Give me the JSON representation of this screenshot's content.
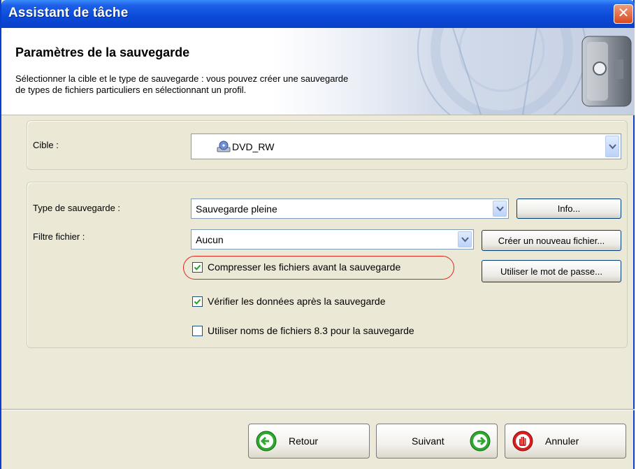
{
  "window": {
    "title": "Assistant de tâche",
    "close_glyph": "✕"
  },
  "header": {
    "title": "Paramètres de la sauvegarde",
    "description_line1": "Sélectionner la cible et le type de sauvegarde : vous pouvez créer une sauvegarde",
    "description_line2": "de types de fichiers particuliers en sélectionnant un profil.",
    "art_icon": "safe-icon"
  },
  "target": {
    "label": "Cible :",
    "value": "DVD_RW",
    "icon": "optical-drive-icon"
  },
  "backup": {
    "type_label": "Type de sauvegarde :",
    "type_value": "Sauvegarde pleine",
    "info_button": "Info...",
    "filter_label": "Filtre fichier :",
    "filter_value": "Aucun",
    "new_file_button": "Créer un nouveau fichier...",
    "password_button": "Utiliser le mot de passe...",
    "options": [
      {
        "label": "Compresser les fichiers avant la sauvegarde",
        "checked": true
      },
      {
        "label": "Vérifier les données après la sauvegarde",
        "checked": true
      },
      {
        "label": "Utiliser noms de fichiers 8.3 pour la sauvegarde",
        "checked": false
      }
    ]
  },
  "footer": {
    "back": "Retour",
    "next": "Suivant",
    "cancel": "Annuler"
  },
  "colors": {
    "titlebar": "#0a4ad8",
    "highlight": "#e0241e",
    "green_nav": "#2ea82e",
    "red_cancel": "#d81e1e"
  }
}
